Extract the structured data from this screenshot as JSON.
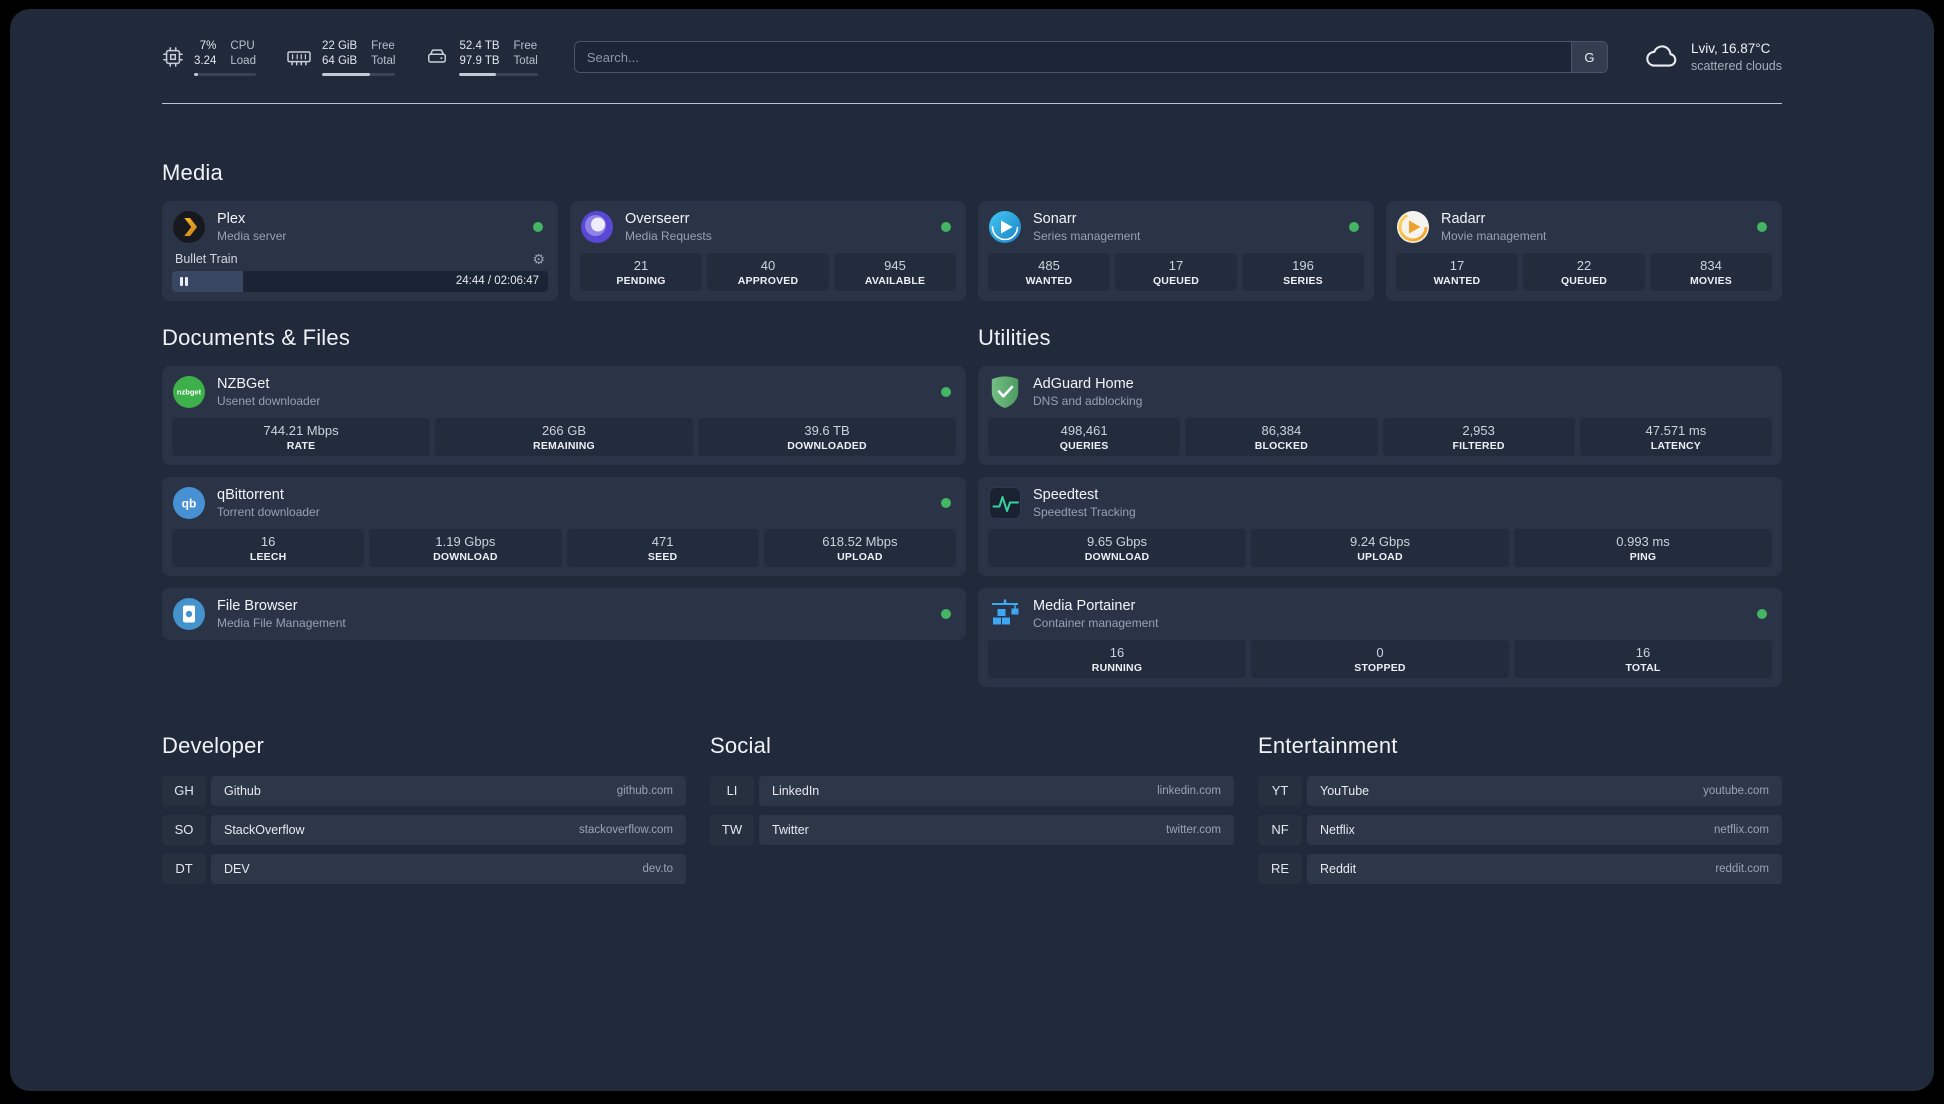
{
  "topbar": {
    "resources": [
      {
        "icon": "cpu-icon",
        "values": [
          "7%",
          "3.24"
        ],
        "labels": [
          "CPU",
          "Load"
        ],
        "percent": 7
      },
      {
        "icon": "memory-icon",
        "values": [
          "22 GiB",
          "64 GiB"
        ],
        "labels": [
          "Free",
          "Total"
        ],
        "percent": 66
      },
      {
        "icon": "disk-icon",
        "values": [
          "52.4 TB",
          "97.9 TB"
        ],
        "labels": [
          "Free",
          "Total"
        ],
        "percent": 46
      }
    ],
    "search": {
      "placeholder": "Search...",
      "provider_button": "G"
    },
    "weather": {
      "icon": "cloud-icon",
      "location": "Lviv, 16.87°C",
      "condition": "scattered clouds"
    }
  },
  "status_color": "#43b563",
  "sections": {
    "media": {
      "heading": "Media",
      "cards": [
        {
          "icon": "plex-icon",
          "name": "Plex",
          "desc": "Media server",
          "status_color": "#43b563",
          "player": {
            "title": "Bullet Train",
            "time": "24:44 / 02:06:47",
            "progress_percent": 19
          }
        },
        {
          "icon": "overseerr-icon",
          "name": "Overseerr",
          "desc": "Media Requests",
          "status_color": "#43b563",
          "stats": [
            {
              "value": "21",
              "label": "PENDING"
            },
            {
              "value": "40",
              "label": "APPROVED"
            },
            {
              "value": "945",
              "label": "AVAILABLE"
            }
          ]
        },
        {
          "icon": "sonarr-icon",
          "name": "Sonarr",
          "desc": "Series management",
          "status_color": "#43b563",
          "stats": [
            {
              "value": "485",
              "label": "WANTED"
            },
            {
              "value": "17",
              "label": "QUEUED"
            },
            {
              "value": "196",
              "label": "SERIES"
            }
          ]
        },
        {
          "icon": "radarr-icon",
          "name": "Radarr",
          "desc": "Movie management",
          "status_color": "#43b563",
          "stats": [
            {
              "value": "17",
              "label": "WANTED"
            },
            {
              "value": "22",
              "label": "QUEUED"
            },
            {
              "value": "834",
              "label": "MOVIES"
            }
          ]
        }
      ]
    },
    "documents": {
      "heading": "Documents & Files",
      "cards": [
        {
          "icon": "nzbget-icon",
          "icon_text": "nzbget",
          "name": "NZBGet",
          "desc": "Usenet downloader",
          "status_color": "#43b563",
          "stats": [
            {
              "value": "744.21 Mbps",
              "label": "RATE"
            },
            {
              "value": "266 GB",
              "label": "REMAINING"
            },
            {
              "value": "39.6 TB",
              "label": "DOWNLOADED"
            }
          ]
        },
        {
          "icon": "qbittorrent-icon",
          "icon_text": "qb",
          "name": "qBittorrent",
          "desc": "Torrent downloader",
          "status_color": "#43b563",
          "stats": [
            {
              "value": "16",
              "label": "LEECH"
            },
            {
              "value": "1.19 Gbps",
              "label": "DOWNLOAD"
            },
            {
              "value": "471",
              "label": "SEED"
            },
            {
              "value": "618.52 Mbps",
              "label": "UPLOAD"
            }
          ]
        },
        {
          "icon": "filebrowser-icon",
          "name": "File Browser",
          "desc": "Media File Management",
          "status_color": "#43b563"
        }
      ]
    },
    "utilities": {
      "heading": "Utilities",
      "cards": [
        {
          "icon": "adguard-icon",
          "name": "AdGuard Home",
          "desc": "DNS and adblocking",
          "stats": [
            {
              "value": "498,461",
              "label": "QUERIES"
            },
            {
              "value": "86,384",
              "label": "BLOCKED"
            },
            {
              "value": "2,953",
              "label": "FILTERED"
            },
            {
              "value": "47.571 ms",
              "label": "LATENCY"
            }
          ]
        },
        {
          "icon": "speedtest-icon",
          "name": "Speedtest",
          "desc": "Speedtest Tracking",
          "stats": [
            {
              "value": "9.65 Gbps",
              "label": "DOWNLOAD"
            },
            {
              "value": "9.24 Gbps",
              "label": "UPLOAD"
            },
            {
              "value": "0.993 ms",
              "label": "PING"
            }
          ]
        },
        {
          "icon": "portainer-icon",
          "name": "Media Portainer",
          "desc": "Container management",
          "status_color": "#43b563",
          "stats": [
            {
              "value": "16",
              "label": "RUNNING"
            },
            {
              "value": "0",
              "label": "STOPPED"
            },
            {
              "value": "16",
              "label": "TOTAL"
            }
          ]
        }
      ]
    },
    "bookmarks": [
      {
        "heading": "Developer",
        "items": [
          {
            "abbr": "GH",
            "name": "Github",
            "url": "github.com"
          },
          {
            "abbr": "SO",
            "name": "StackOverflow",
            "url": "stackoverflow.com"
          },
          {
            "abbr": "DT",
            "name": "DEV",
            "url": "dev.to"
          }
        ]
      },
      {
        "heading": "Social",
        "items": [
          {
            "abbr": "LI",
            "name": "LinkedIn",
            "url": "linkedin.com"
          },
          {
            "abbr": "TW",
            "name": "Twitter",
            "url": "twitter.com"
          }
        ]
      },
      {
        "heading": "Entertainment",
        "items": [
          {
            "abbr": "YT",
            "name": "YouTube",
            "url": "youtube.com"
          },
          {
            "abbr": "NF",
            "name": "Netflix",
            "url": "netflix.com"
          },
          {
            "abbr": "RE",
            "name": "Reddit",
            "url": "reddit.com"
          }
        ]
      }
    ]
  }
}
